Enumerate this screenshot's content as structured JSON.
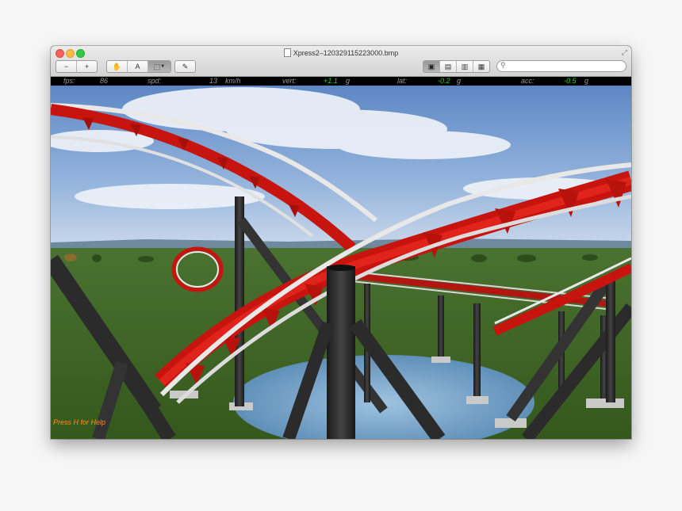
{
  "window": {
    "title": "Xpress2–120329115223000.bmp"
  },
  "toolbar": {
    "zoom_out": "−",
    "zoom_in": "+",
    "pan": "✋",
    "text_select": "A",
    "rect_select": "⬚",
    "annotate": "✎",
    "view_modes": [
      "▣",
      "▤",
      "▥",
      "▦"
    ],
    "search_placeholder": ""
  },
  "hud": {
    "fps_label": "fps:",
    "fps_value": "86",
    "spd_label": "spd:",
    "spd_value": "13",
    "spd_unit": "km/h",
    "vert_label": "vert:",
    "vert_value": "+1.1",
    "vert_unit": "g",
    "lat_label": "lat:",
    "lat_value": "-0.2",
    "lat_unit": "g",
    "acc_label": "acc:",
    "acc_value": "-0.5",
    "acc_unit": "g"
  },
  "help_text": "Press H for Help",
  "colors": {
    "track_red": "#c8140e",
    "rail_white": "#e8e8e8",
    "support_dark": "#2b2b2b",
    "grass": "#3f6a24",
    "sky_top": "#5d87c4"
  }
}
